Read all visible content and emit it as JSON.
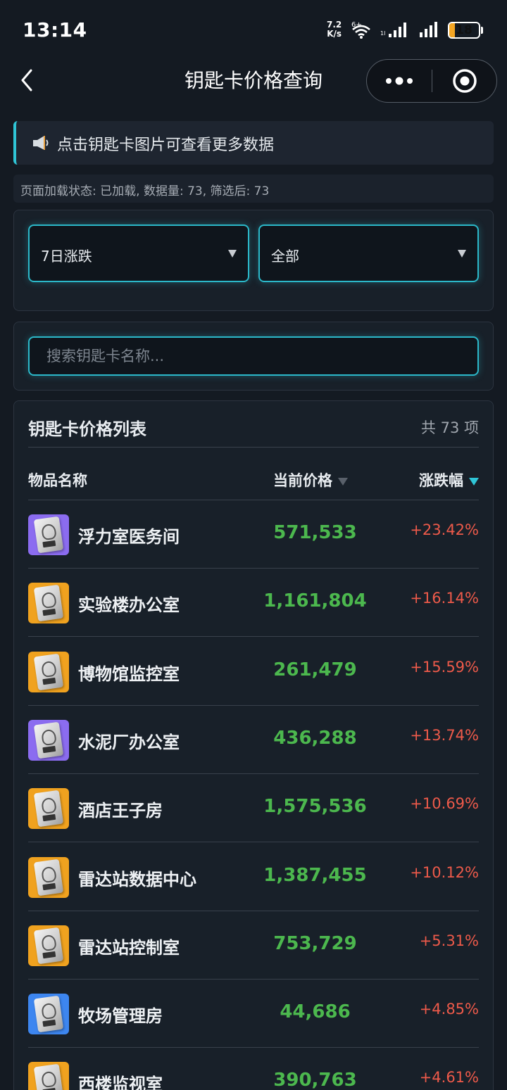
{
  "status_bar": {
    "time": "13:14",
    "net_speed_value": "7.2",
    "net_speed_unit": "K/s",
    "wifi_label": "6+",
    "battery": "18",
    "battery_level": 0.18
  },
  "nav": {
    "title": "钥匙卡价格查询",
    "back_icon": "chevron-left-icon",
    "more_icon": "more-dots-icon",
    "close_icon": "target-circle-icon"
  },
  "notice": {
    "icon": "speaker-icon",
    "text": "点击钥匙卡图片可查看更多数据"
  },
  "load_status": "页面加载状态: 已加载, 数据量: 73, 筛选后: 73",
  "filters": {
    "period": "7日涨跌",
    "category": "全部"
  },
  "search": {
    "placeholder": "搜索钥匙卡名称..."
  },
  "list": {
    "title": "钥匙卡价格列表",
    "count": "共 73 项",
    "headers": {
      "name": "物品名称",
      "price": "当前价格",
      "change": "涨跌幅"
    },
    "sort_active": "change",
    "rows": [
      {
        "name": "浮力室医务间",
        "price": "571,533",
        "change": "+23.42%",
        "rarity_color": "#8b6cf0"
      },
      {
        "name": "实验楼办公室",
        "price": "1,161,804",
        "change": "+16.14%",
        "rarity_color": "#f0a21f"
      },
      {
        "name": "博物馆监控室",
        "price": "261,479",
        "change": "+15.59%",
        "rarity_color": "#f0a21f"
      },
      {
        "name": "水泥厂办公室",
        "price": "436,288",
        "change": "+13.74%",
        "rarity_color": "#8b6cf0"
      },
      {
        "name": "酒店王子房",
        "price": "1,575,536",
        "change": "+10.69%",
        "rarity_color": "#f0a21f"
      },
      {
        "name": "雷达站数据中心",
        "price": "1,387,455",
        "change": "+10.12%",
        "rarity_color": "#f0a21f"
      },
      {
        "name": "雷达站控制室",
        "price": "753,729",
        "change": "+5.31%",
        "rarity_color": "#f0a21f"
      },
      {
        "name": "牧场管理房",
        "price": "44,686",
        "change": "+4.85%",
        "rarity_color": "#3d86f0"
      },
      {
        "name": "西楼监视室",
        "price": "390,763",
        "change": "+4.61%",
        "rarity_color": "#f0a21f"
      }
    ]
  }
}
